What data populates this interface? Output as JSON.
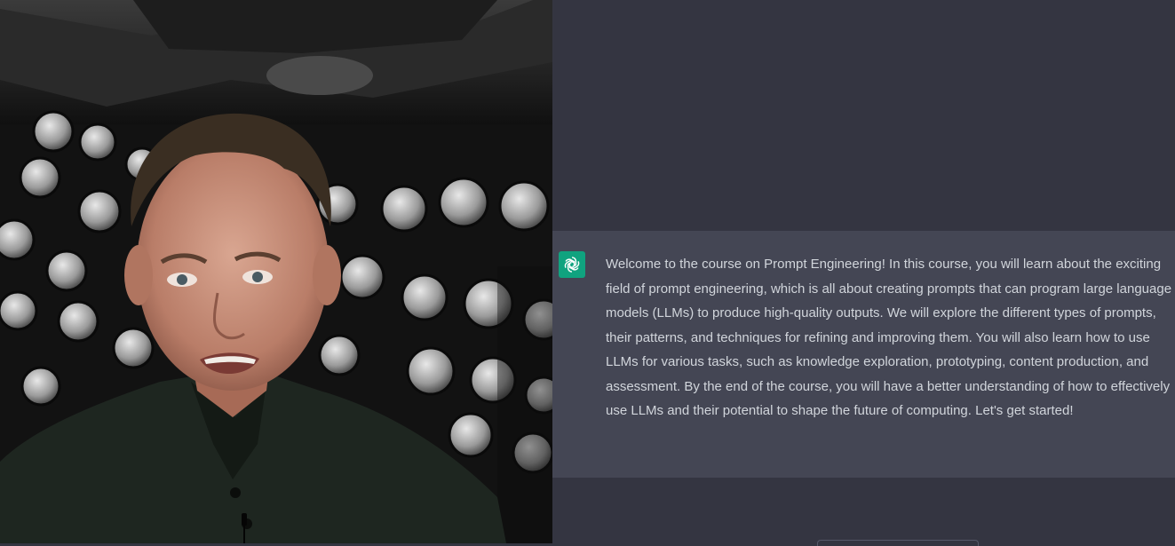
{
  "theme": {
    "chat_background": "#343541",
    "assistant_message_background": "#444654",
    "assistant_avatar_color": "#10a37f",
    "message_text_color": "#d1d5db"
  },
  "video": {
    "subject": "presenter-webcam-feed",
    "icon": "person-video-icon"
  },
  "chat": {
    "assistant_message": {
      "avatar_icon": "openai-logo-icon",
      "text": "Welcome to the course on Prompt Engineering! In this course, you will learn about the exciting field of prompt engineering, which is all about creating prompts that can program large language models (LLMs) to produce high-quality outputs. We will explore the different types of prompts, their patterns, and techniques for refining and improving them. You will also learn how to use LLMs for various tasks, such as knowledge exploration, prototyping, content production, and assessment. By the end of the course, you will have a better understanding of how to effectively use LLMs and their potential to shape the future of computing. Let's get started!"
    }
  }
}
